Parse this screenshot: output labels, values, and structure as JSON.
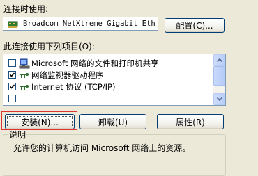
{
  "connect_using_label": "连接时使用:",
  "adapter_name": "Broadcom NetXtreme Gigabit Eth",
  "configure_button": "配置(C)...",
  "components_label": "此连接使用下列项目(O):",
  "components": [
    {
      "label": "Microsoft 网络的文件和打印机共享",
      "checked": false,
      "icon": "network-printer-icon"
    },
    {
      "label": "网络监视器驱动程序",
      "checked": true,
      "icon": "protocol-icon"
    },
    {
      "label": "Internet 协议 (TCP/IP)",
      "checked": true,
      "icon": "protocol-icon"
    }
  ],
  "install_button": "安装(N)...",
  "uninstall_button": "卸载(U)",
  "properties_button": "属性(R)",
  "description_group_title": "说明",
  "description_text": "允许您的计算机访问 Microsoft 网络上的资源。",
  "colors": {
    "highlight_frame": "#dd3333",
    "dialog_bg": "#ece9d8"
  }
}
